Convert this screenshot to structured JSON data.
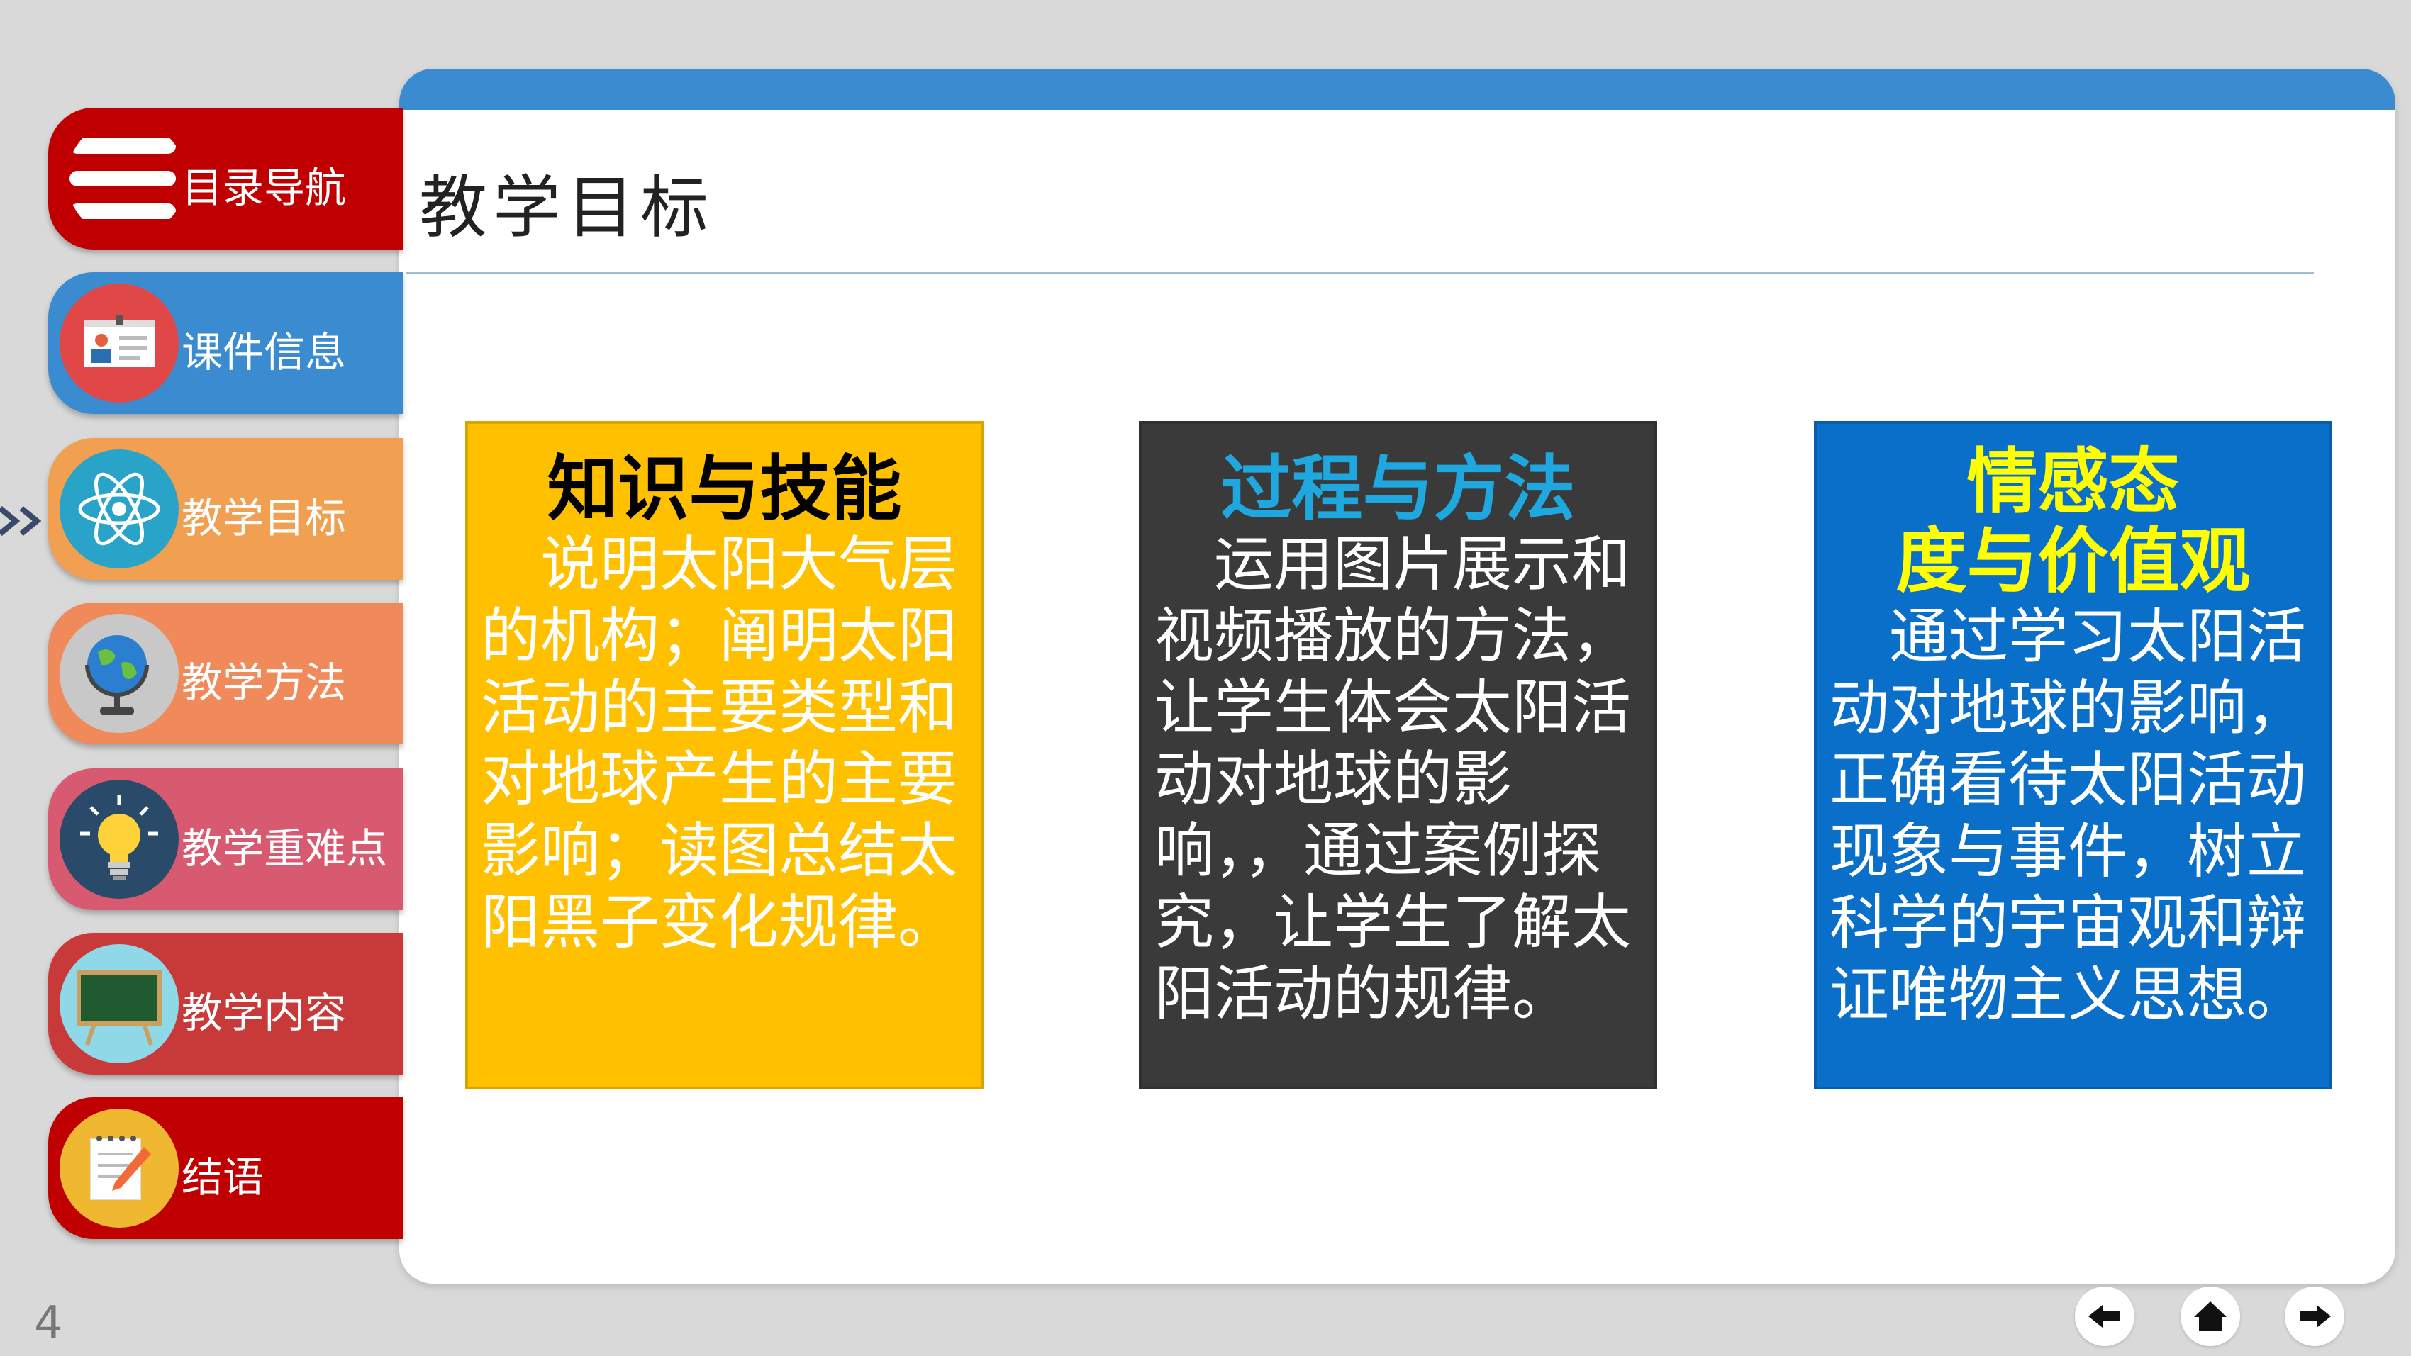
{
  "slide": {
    "title": "教学目标",
    "page_number": "4"
  },
  "sidebar": {
    "items": [
      {
        "label": "目录导航",
        "color": "#c00000",
        "icon": "menu-icon"
      },
      {
        "label": "课件信息",
        "color": "#3a8bd0",
        "icon": "id-card-icon"
      },
      {
        "label": "教学目标",
        "color": "#f0a050",
        "icon": "atom-icon"
      },
      {
        "label": "教学方法",
        "color": "#f08a5a",
        "icon": "globe-icon"
      },
      {
        "label": "教学重难点",
        "color": "#d85a70",
        "icon": "lightbulb-icon"
      },
      {
        "label": "教学内容",
        "color": "#c83a3a",
        "icon": "blackboard-icon"
      },
      {
        "label": "结语",
        "color": "#c00000",
        "icon": "notepad-icon"
      }
    ],
    "active_index": 2
  },
  "cards": [
    {
      "title": "知识与技能",
      "body": "　说明太阳大气层的机构；阐明太阳活动的主要类型和对地球产生的主要影响；读图总结太阳黑子变化规律。",
      "bg": "#ffc000",
      "title_color": "#000000",
      "body_color": "#ffffff"
    },
    {
      "title": "过程与方法",
      "body": "　运用图片展示和视频播放的方法，让学生体会太阳活动对地球的影响，，通过案例探究，让学生了解太阳活动的规律。",
      "bg": "#3a3a3a",
      "title_color": "#1fa8e0",
      "body_color": "#ffffff"
    },
    {
      "title": "情感态度与价值观",
      "title_line1": "情感态",
      "title_line2": "度与价值观",
      "body": "　通过学习太阳活动对地球的影响，正确看待太阳活动现象与事件，树立科学的宇宙观和辩证唯物主义思想。",
      "bg": "#0a6fc8",
      "title_color": "#ffff00",
      "body_color": "#ffffff"
    }
  ],
  "footer": {
    "prev": "arrow-left-icon",
    "home": "home-icon",
    "next": "arrow-right-icon"
  }
}
